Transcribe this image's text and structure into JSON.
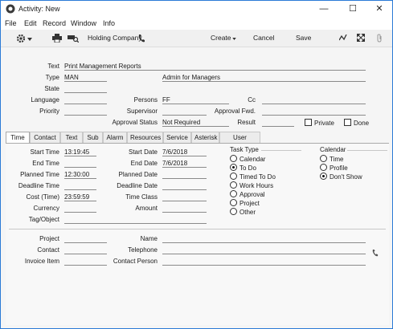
{
  "window": {
    "title": "Activity: New",
    "controls": {
      "minimize": "—",
      "maximize": "☐",
      "close": "✕"
    }
  },
  "menu": [
    "File",
    "Edit",
    "Record",
    "Window",
    "Info"
  ],
  "toolbar": {
    "company": "Holding Company",
    "create_label": "Create",
    "cancel_label": "Cancel",
    "save_label": "Save"
  },
  "header": {
    "text_label": "Text",
    "text_value": "Print Management Reports",
    "type_label": "Type",
    "type_value": "MAN",
    "type_desc": "Admin for Managers",
    "state_label": "State",
    "state_value": "",
    "language_label": "Language",
    "language_value": "",
    "persons_label": "Persons",
    "persons_value": "FF",
    "cc_label": "Cc",
    "cc_value": "",
    "priority_label": "Priority",
    "priority_value": "",
    "supervisor_label": "Supervisor",
    "supervisor_value": "",
    "approval_fwd_label": "Approval Fwd.",
    "approval_fwd_value": "",
    "approval_status_label": "Approval Status",
    "approval_status_value": "Not Required",
    "result_label": "Result",
    "result_value": "",
    "private_label": "Private",
    "done_label": "Done"
  },
  "tabs": [
    "Time",
    "Contact",
    "Text",
    "Sub",
    "Alarm",
    "Resources",
    "Service",
    "Asterisk",
    "User Defined"
  ],
  "time": {
    "start_time_label": "Start Time",
    "start_time": "13:19:45",
    "end_time_label": "End Time",
    "end_time": "",
    "planned_time_label": "Planned Time",
    "planned_time": "12:30:00",
    "deadline_time_label": "Deadline Time",
    "deadline_time": "",
    "cost_time_label": "Cost (Time)",
    "cost_time": "23:59:59",
    "currency_label": "Currency",
    "currency": "",
    "tag_label": "Tag/Object",
    "tag": "",
    "start_date_label": "Start Date",
    "start_date": "7/6/2018",
    "end_date_label": "End Date",
    "end_date": "7/6/2018",
    "planned_date_label": "Planned Date",
    "planned_date": "",
    "deadline_date_label": "Deadline Date",
    "deadline_date": "",
    "time_class_label": "Time Class",
    "time_class": "",
    "amount_label": "Amount",
    "amount": ""
  },
  "task_type": {
    "label": "Task Type",
    "options": [
      "Calendar",
      "To Do",
      "Timed To Do",
      "Work Hours",
      "Approval",
      "Project",
      "Other"
    ],
    "selected": "To Do"
  },
  "calendar": {
    "label": "Calendar",
    "options": [
      "Time",
      "Profile",
      "Don't Show"
    ],
    "selected": "Don't Show"
  },
  "bottom": {
    "project_label": "Project",
    "project": "",
    "contact_label": "Contact",
    "contact": "",
    "invoice_item_label": "Invoice Item",
    "invoice_item": "",
    "name_label": "Name",
    "name": "",
    "telephone_label": "Telephone",
    "telephone": "",
    "contact_person_label": "Contact Person",
    "contact_person": ""
  }
}
